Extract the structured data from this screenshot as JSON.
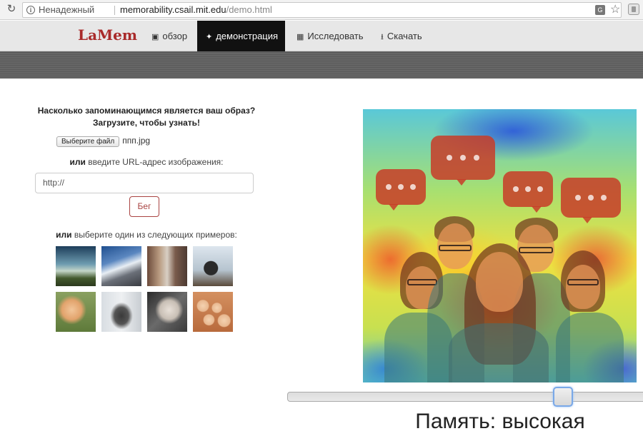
{
  "browser": {
    "security_label": "Ненадежный",
    "url_host": "memorability.csail.mit.edu",
    "url_path": "/demo.html"
  },
  "nav": {
    "brand": "LaMem",
    "items": [
      {
        "label": "обзор",
        "icon": "image-icon"
      },
      {
        "label": "демонстрация",
        "icon": "magic-wand-icon"
      },
      {
        "label": "Исследовать",
        "icon": "grid-icon"
      },
      {
        "label": "Скачать",
        "icon": "download-icon"
      }
    ],
    "active": "демонстрация"
  },
  "upload": {
    "question_line1": "Насколько запоминающимся является ваш образ?",
    "question_line2": "Загрузите, чтобы узнать!",
    "file_button": "Выберите файл",
    "file_name": "ппп.jpg",
    "or_word": "или",
    "url_prompt": " введите URL-адрес изображения:",
    "url_value": "http://",
    "run_button": "Бег",
    "examples_prompt": " выберите один из следующих примеров:"
  },
  "result": {
    "memory_label": "Память: высокая",
    "slider_level": 0.73
  },
  "colors": {
    "brand": "#a92a2a",
    "active_nav_bg": "#111111",
    "run_border": "#a94442"
  }
}
